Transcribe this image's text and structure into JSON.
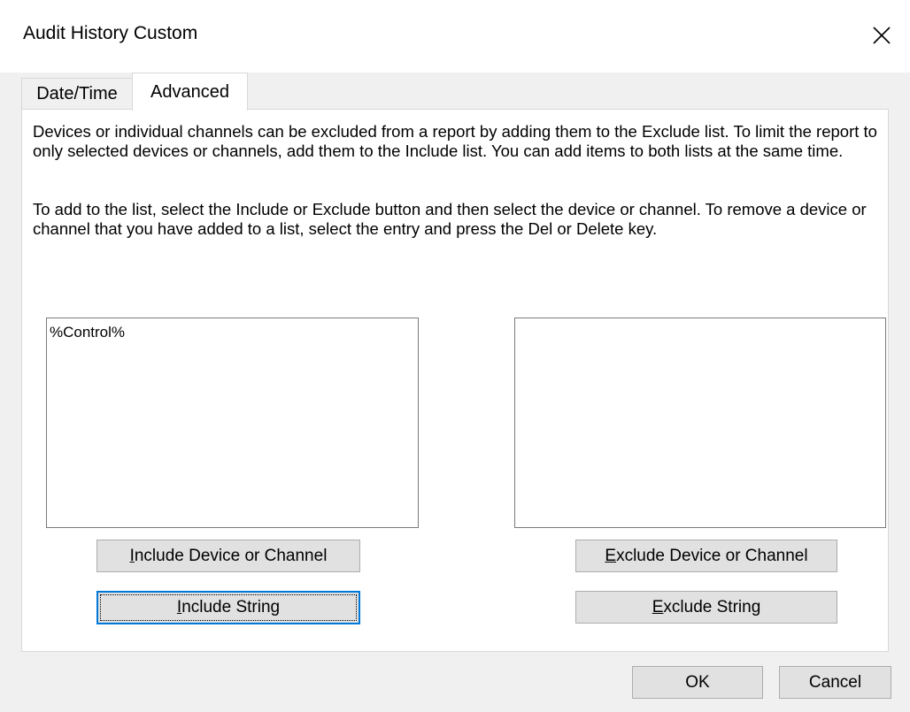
{
  "window": {
    "title": "Audit History Custom",
    "close_icon": "close-icon"
  },
  "tabs": [
    {
      "label": "Date/Time",
      "active": false
    },
    {
      "label": "Advanced",
      "active": true
    }
  ],
  "advanced": {
    "paragraph1": "Devices or individual channels can be excluded from a report by adding them to the Exclude list. To limit the report to only selected devices or channels, add them to the Include list. You can add items to both lists at the same time.",
    "paragraph2": "To add to the list, select the Include or Exclude button and then select the device or channel. To remove a device or channel that you have added to a list, select the entry and press the Del or Delete key.",
    "include_list": [
      "%Control%"
    ],
    "exclude_list": [],
    "include_device_button": {
      "mnemonic": "I",
      "rest": "nclude Device or Channel"
    },
    "include_string_button": {
      "mnemonic": "I",
      "rest": "nclude String",
      "focused": true
    },
    "exclude_device_button": {
      "mnemonic": "E",
      "rest": "xclude Device or Channel"
    },
    "exclude_string_button": {
      "mnemonic": "E",
      "rest": "xclude String"
    }
  },
  "footer": {
    "ok_label": "OK",
    "cancel_label": "Cancel"
  },
  "colors": {
    "focus_accent": "#0078d7",
    "dialog_bg": "#f0f0f0",
    "button_bg": "#e1e1e1"
  }
}
